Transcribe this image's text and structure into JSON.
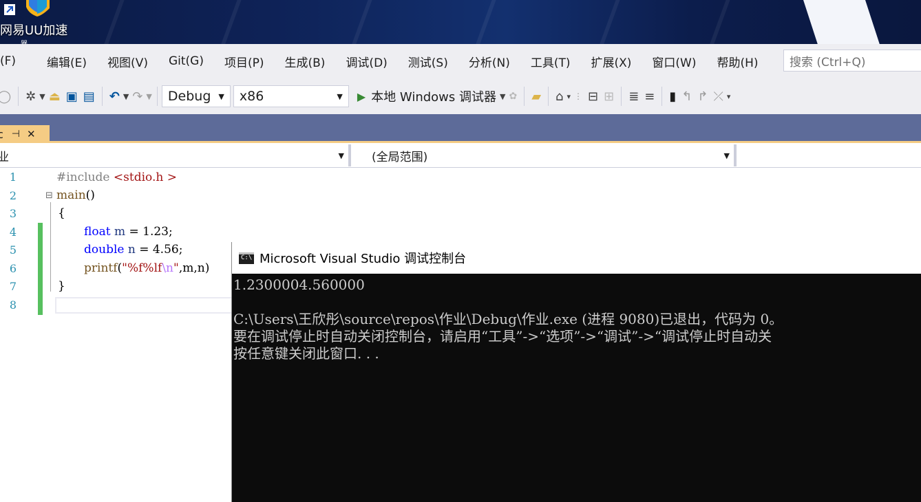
{
  "desktop": {
    "shortcut_label": "网易UU加速",
    "shortcut_label_line2": "器"
  },
  "menu": {
    "items": [
      "(F)",
      "编辑(E)",
      "视图(V)",
      "Git(G)",
      "项目(P)",
      "生成(B)",
      "调试(D)",
      "测试(S)",
      "分析(N)",
      "工具(T)",
      "扩展(X)",
      "窗口(W)",
      "帮助(H)"
    ],
    "search_placeholder": "搜索 (Ctrl+Q)"
  },
  "toolbar": {
    "configuration": "Debug",
    "platform": "x86",
    "run_label": "本地 Windows 调试器"
  },
  "tab": {
    "title_fragment": "c",
    "pin_glyph": "⊣",
    "close_glyph": "✕"
  },
  "navbar": {
    "project": "业",
    "scope": "(全局范围)"
  },
  "editor": {
    "line_numbers": [
      "1",
      "2",
      "3",
      "4",
      "5",
      "6",
      "7",
      "8"
    ],
    "lines": {
      "l1_pp": "#include ",
      "l1_header": "<stdio.h >",
      "l2_fn": "main",
      "l2_parens": "()",
      "l3": "{",
      "l4_kw": "float",
      "l4_var": " m",
      "l4_rest": " = 1.23;",
      "l5_kw": "double",
      "l5_var": " n",
      "l5_rest": " = 4.56;",
      "l6_fn": "printf",
      "l6_open": "(",
      "l6_str1": "\"%f%lf",
      "l6_esc": "\\n",
      "l6_str2": "\"",
      "l6_rest": ",m,n)",
      "l7": "}"
    }
  },
  "console": {
    "title": "Microsoft Visual Studio 调试控制台",
    "icon_text": "C:\\",
    "lines": [
      "1.2300004.560000",
      "",
      "C:\\Users\\王欣彤\\source\\repos\\作业\\Debug\\作业.exe (进程 9080)已退出，代码为 0。",
      "要在调试停止时自动关闭控制台，请启用“工具”->“选项”->“调试”->“调试停止时自动关",
      "按任意键关闭此窗口. . ."
    ]
  },
  "colors": {
    "accent_tab": "#f5cc84",
    "tab_row": "#5d6b99",
    "chrome": "#eeeef2",
    "change_bar": "#57c05f"
  }
}
